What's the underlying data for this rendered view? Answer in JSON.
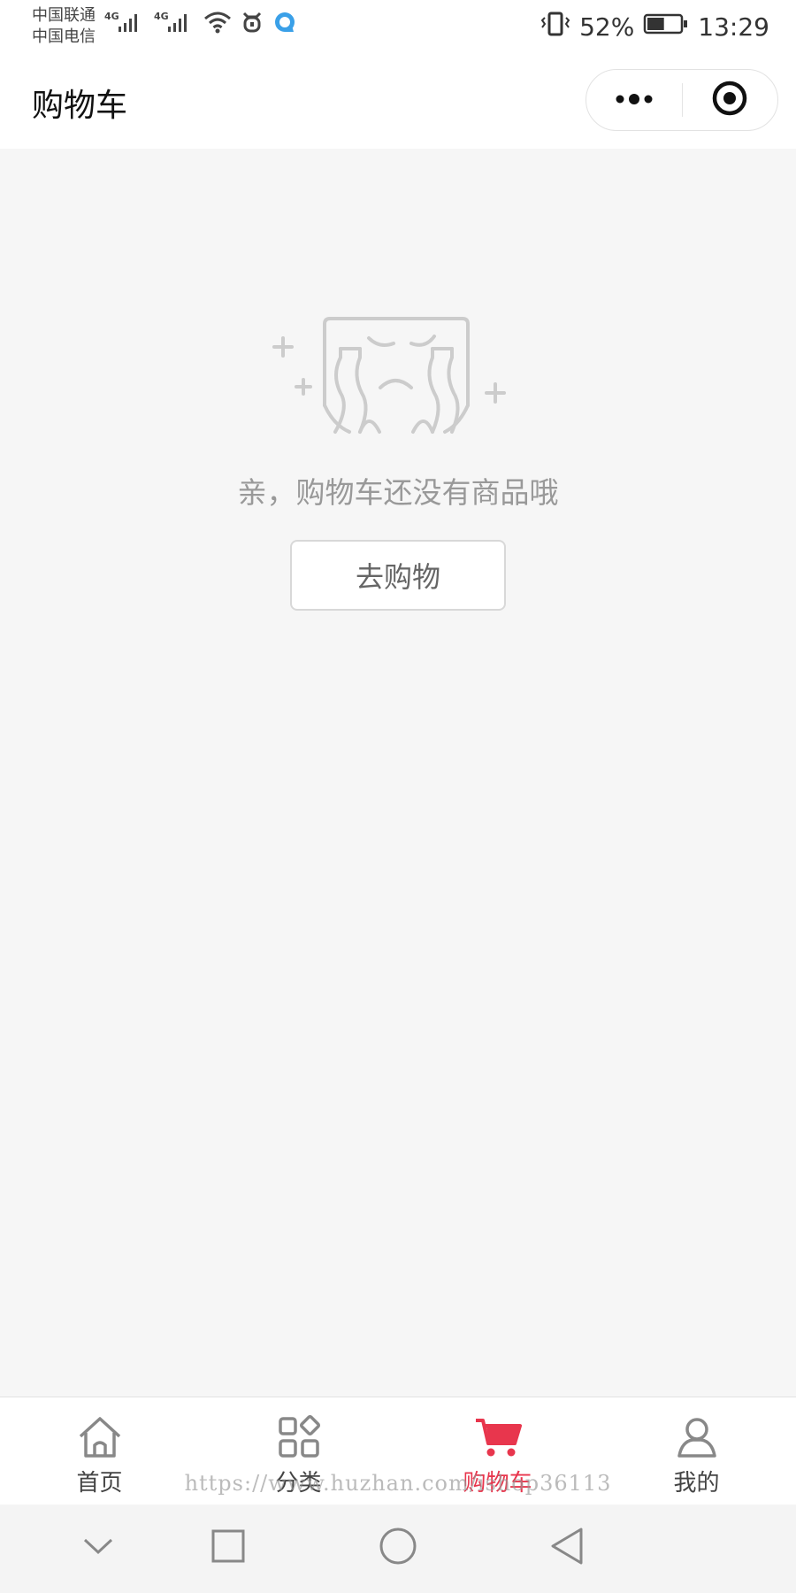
{
  "status_bar": {
    "carrier_1": "中国联通",
    "carrier_2": "中国电信",
    "network_1": "4G",
    "network_2": "4G",
    "battery_percent": "52%",
    "battery_level": 0.52,
    "time": "13:29"
  },
  "nav_bar": {
    "title": "购物车"
  },
  "empty_state": {
    "message": "亲，购物车还没有商品哦",
    "button_label": "去购物"
  },
  "tab_bar": {
    "active_index": 2,
    "active_color": "#e8364d",
    "items": [
      {
        "label": "首页",
        "icon": "home-icon"
      },
      {
        "label": "分类",
        "icon": "category-icon"
      },
      {
        "label": "购物车",
        "icon": "cart-icon"
      },
      {
        "label": "我的",
        "icon": "user-icon"
      }
    ]
  },
  "watermark": "https://www.huzhan.com/ishop36113",
  "system_nav": {
    "icons": [
      "chevron-down-icon",
      "square-icon",
      "circle-home-icon",
      "back-triangle-icon"
    ]
  }
}
